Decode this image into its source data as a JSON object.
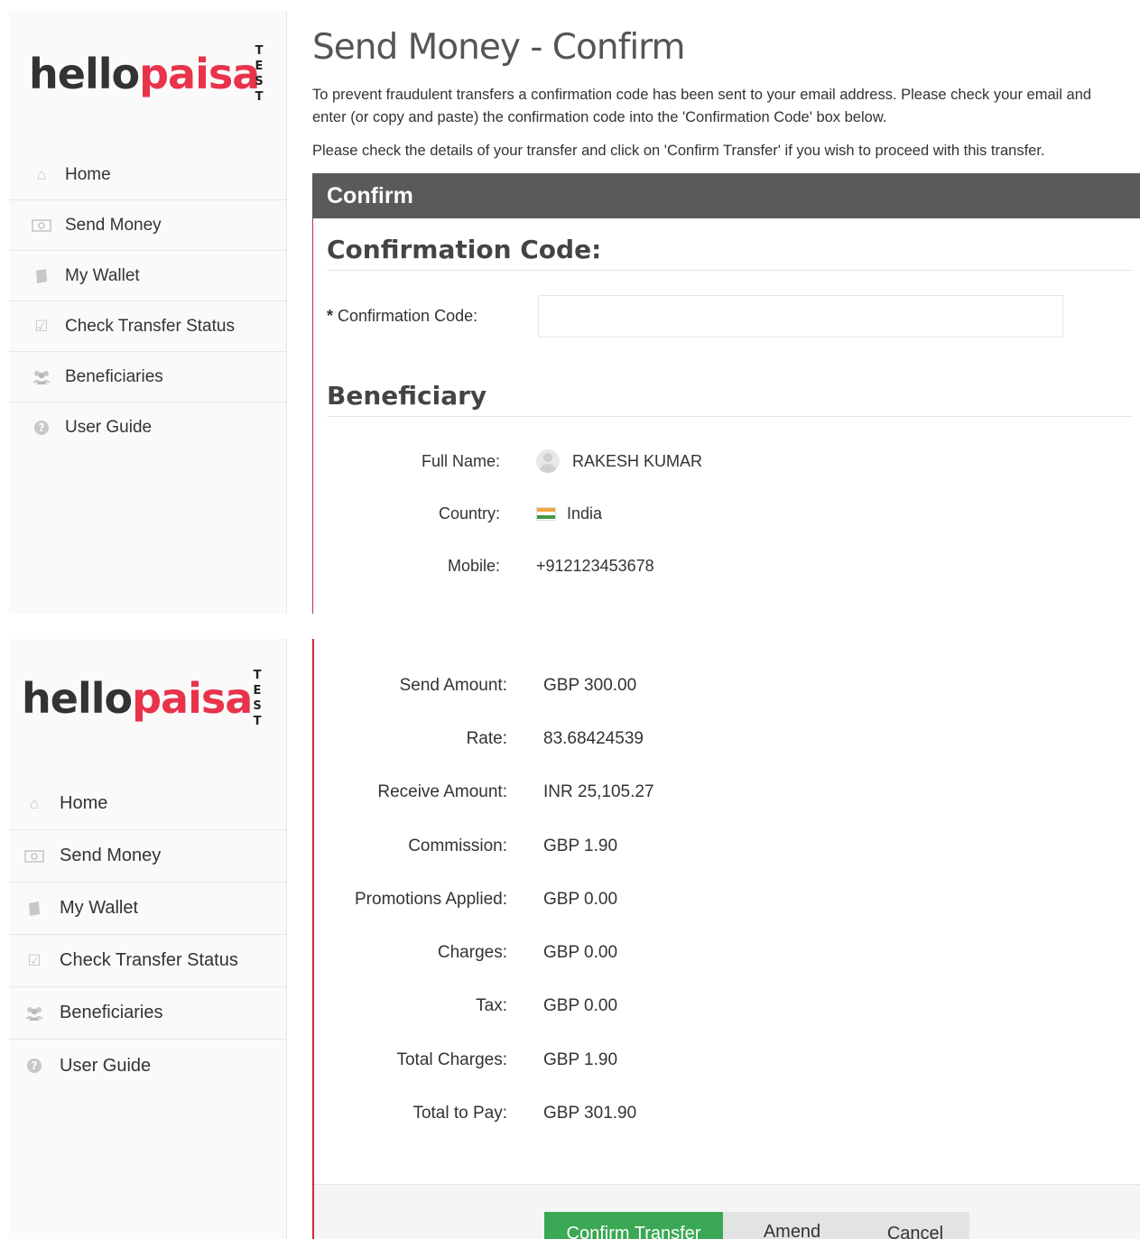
{
  "brand": {
    "logo_hello": "hello",
    "logo_paisa": "paisa",
    "env_letters": [
      "T",
      "E",
      "S",
      "T"
    ]
  },
  "sidebar": {
    "items": [
      {
        "label": "Home",
        "icon": "home-icon"
      },
      {
        "label": "Send Money",
        "icon": "money-icon"
      },
      {
        "label": "My Wallet",
        "icon": "wallet-icon"
      },
      {
        "label": "Check Transfer Status",
        "icon": "check-icon"
      },
      {
        "label": "Beneficiaries",
        "icon": "users-icon"
      },
      {
        "label": "User Guide",
        "icon": "question-icon"
      }
    ]
  },
  "page": {
    "title": "Send Money - Confirm",
    "intro_1": "To prevent fraudulent transfers a confirmation code has been sent to your email address. Please check your email and enter (or copy and paste) the confirmation code into the 'Confirmation Code' box below.",
    "intro_2": "Please check the details of your transfer and click on 'Confirm Transfer' if you wish to proceed with this transfer.",
    "section_bar": "Confirm"
  },
  "confirmation": {
    "section_title": "Confirmation Code:",
    "field_required": "*",
    "field_label": "Confirmation Code:",
    "field_value": ""
  },
  "beneficiary": {
    "section_title": "Beneficiary",
    "full_name_label": "Full Name:",
    "full_name": "RAKESH KUMAR",
    "country_label": "Country:",
    "country": "India",
    "mobile_label": "Mobile:",
    "mobile": "+912123453678"
  },
  "amounts": [
    {
      "label": "Send Amount:",
      "value": "GBP 300.00"
    },
    {
      "label": "Rate:",
      "value": "83.68424539"
    },
    {
      "label": "Receive Amount:",
      "value": "INR 25,105.27"
    },
    {
      "label": "Commission:",
      "value": "GBP 1.90"
    },
    {
      "label": "Promotions Applied:",
      "value": "GBP 0.00"
    },
    {
      "label": "Charges:",
      "value": "GBP 0.00"
    },
    {
      "label": "Tax:",
      "value": "GBP 0.00"
    },
    {
      "label": "Total Charges:",
      "value": "GBP 1.90"
    },
    {
      "label": "Total to Pay:",
      "value": "GBP 301.90"
    }
  ],
  "actions": {
    "confirm": "Confirm Transfer",
    "amend": "Amend Details",
    "cancel": "Cancel"
  },
  "colors": {
    "brand_red": "#e8334a",
    "confirm_green": "#3aa854",
    "section_bar": "#5a5a5a",
    "accent_border": "#c92b3d"
  }
}
